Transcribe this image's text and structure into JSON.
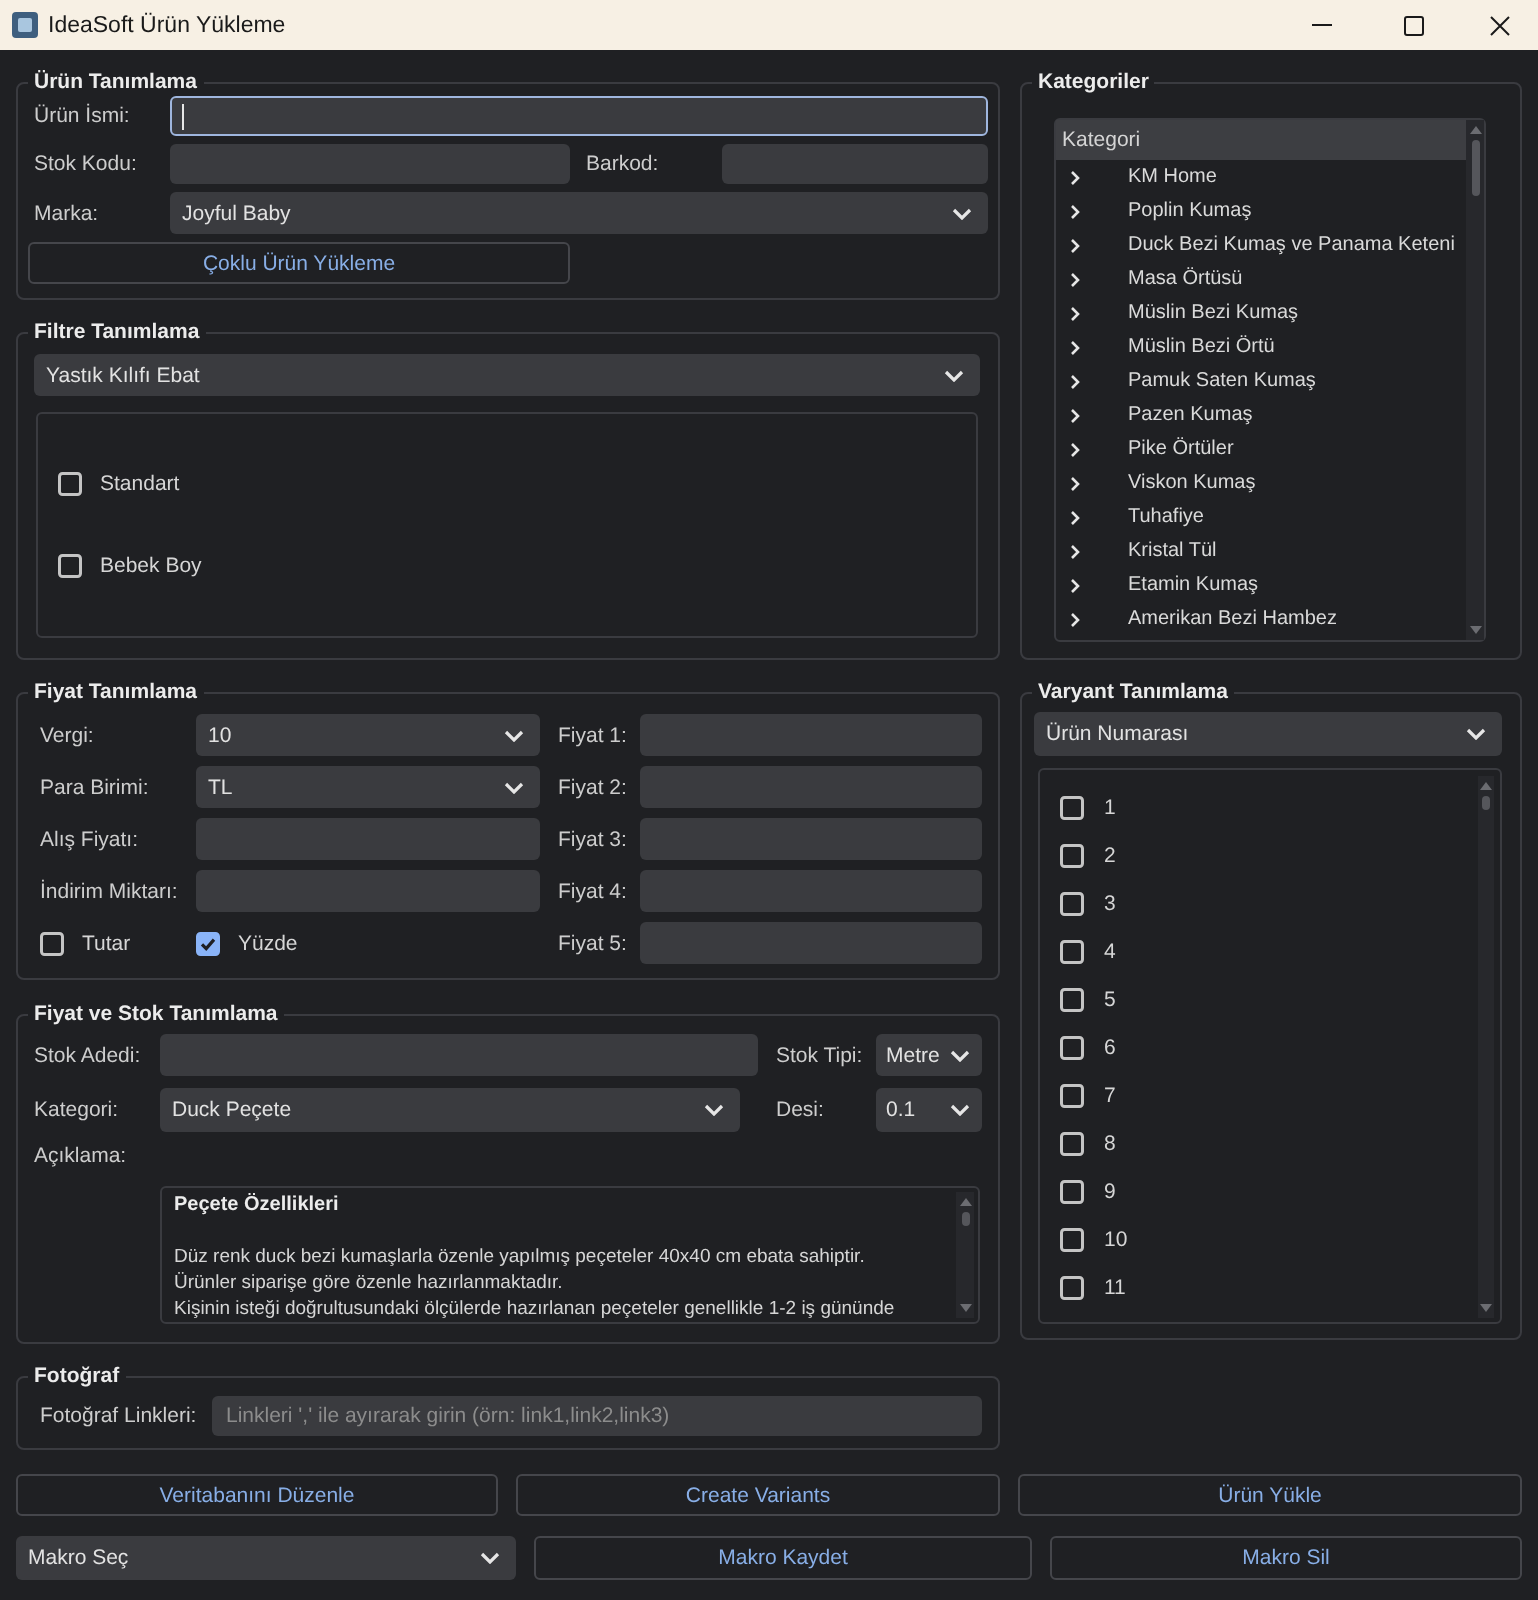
{
  "window": {
    "title": "IdeaSoft Ürün Yükleme"
  },
  "product": {
    "title": "Ürün Tanımlama",
    "name": {
      "label": "Ürün İsmi:",
      "focused": true
    },
    "stock_code": {
      "label": "Stok Kodu:"
    },
    "barcode": {
      "label": "Barkod:"
    },
    "brand": {
      "label": "Marka:",
      "value": "Joyful Baby"
    },
    "bulk_upload_button": "Çoklu Ürün Yükleme"
  },
  "filter": {
    "title": "Filtre Tanımlama",
    "type": "Yastık Kılıfı Ebat",
    "options": [
      {
        "label": "Standart",
        "checked": false
      },
      {
        "label": "Bebek Boy",
        "checked": false
      }
    ]
  },
  "categories": {
    "title": "Kategoriler",
    "header": "Kategori",
    "items": [
      {
        "label": "KM Home",
        "expanded": false
      },
      {
        "label": "Poplin Kumaş",
        "expanded": false
      },
      {
        "label": "Duck Bezi Kumaş ve Panama Keteni",
        "expanded": false
      },
      {
        "label": "Masa Örtüsü",
        "expanded": false
      },
      {
        "label": "Müslin Bezi Kumaş",
        "expanded": false
      },
      {
        "label": "Müslin Bezi Örtü",
        "expanded": false
      },
      {
        "label": "Pamuk Saten Kumaş",
        "expanded": false
      },
      {
        "label": "Pazen Kumaş",
        "expanded": false
      },
      {
        "label": "Pike Örtüler",
        "expanded": false
      },
      {
        "label": "Viskon Kumaş",
        "expanded": false
      },
      {
        "label": "Tuhafiye",
        "expanded": false
      },
      {
        "label": "Kristal Tül",
        "expanded": false
      },
      {
        "label": "Etamin Kumaş",
        "expanded": false
      },
      {
        "label": "Amerikan Bezi Hambez",
        "expanded": false
      }
    ]
  },
  "pricing": {
    "title": "Fiyat Tanımlama",
    "fields": [
      {
        "kind": "select",
        "label": "Vergi:",
        "value": "10"
      },
      {
        "kind": "select",
        "label": "Para Birimi:",
        "value": "TL"
      },
      {
        "kind": "input",
        "label": "Alış Fiyatı:"
      },
      {
        "kind": "input",
        "label": "İndirim Miktarı:"
      }
    ],
    "discount_types": [
      {
        "label": "Tutar",
        "checked": false
      },
      {
        "label": "Yüzde",
        "checked": true
      }
    ],
    "prices": [
      {
        "label": "Fiyat 1:"
      },
      {
        "label": "Fiyat 2:"
      },
      {
        "label": "Fiyat 3:"
      },
      {
        "label": "Fiyat 4:"
      },
      {
        "label": "Fiyat 5:"
      }
    ]
  },
  "stock": {
    "title": "Fiyat ve Stok Tanımlama",
    "quantity": {
      "label": "Stok Adedi:"
    },
    "stock_type": {
      "label": "Stok Tipi:",
      "value": "Metre"
    },
    "category": {
      "label": "Kategori:",
      "value": "Duck Peçete"
    },
    "desi": {
      "label": "Desi:",
      "value": "0.1"
    },
    "description": {
      "label": "Açıklama:",
      "heading": "Peçete Özellikleri",
      "lines": [
        "Düz renk duck bezi kumaşlarla özenle yapılmış peçeteler 40x40 cm ebata sahiptir.",
        "Ürünler siparişe göre özenle hazırlanmaktadır.",
        "Kişinin isteği doğrultusundaki ölçülerde hazırlanan peçeteler genellikle 1-2 iş gününde"
      ]
    }
  },
  "photo": {
    "title": "Fotoğraf",
    "links": {
      "label": "Fotoğraf Linkleri:",
      "placeholder": "Linkleri ',' ile ayırarak girin (örn: link1,link2,link3)"
    }
  },
  "variants": {
    "title": "Varyant Tanımlama",
    "type": "Ürün Numarası",
    "options": [
      {
        "label": "1",
        "checked": false
      },
      {
        "label": "2",
        "checked": false
      },
      {
        "label": "3",
        "checked": false
      },
      {
        "label": "4",
        "checked": false
      },
      {
        "label": "5",
        "checked": false
      },
      {
        "label": "6",
        "checked": false
      },
      {
        "label": "7",
        "checked": false
      },
      {
        "label": "8",
        "checked": false
      },
      {
        "label": "9",
        "checked": false
      },
      {
        "label": "10",
        "checked": false
      },
      {
        "label": "11",
        "checked": false
      }
    ]
  },
  "actions": [
    "Veritabanını Düzenle",
    "Create Variants",
    "Ürün Yükle"
  ],
  "macro": {
    "select": "Makro Seç",
    "buttons": [
      "Makro Kaydet",
      "Makro Sil"
    ]
  }
}
